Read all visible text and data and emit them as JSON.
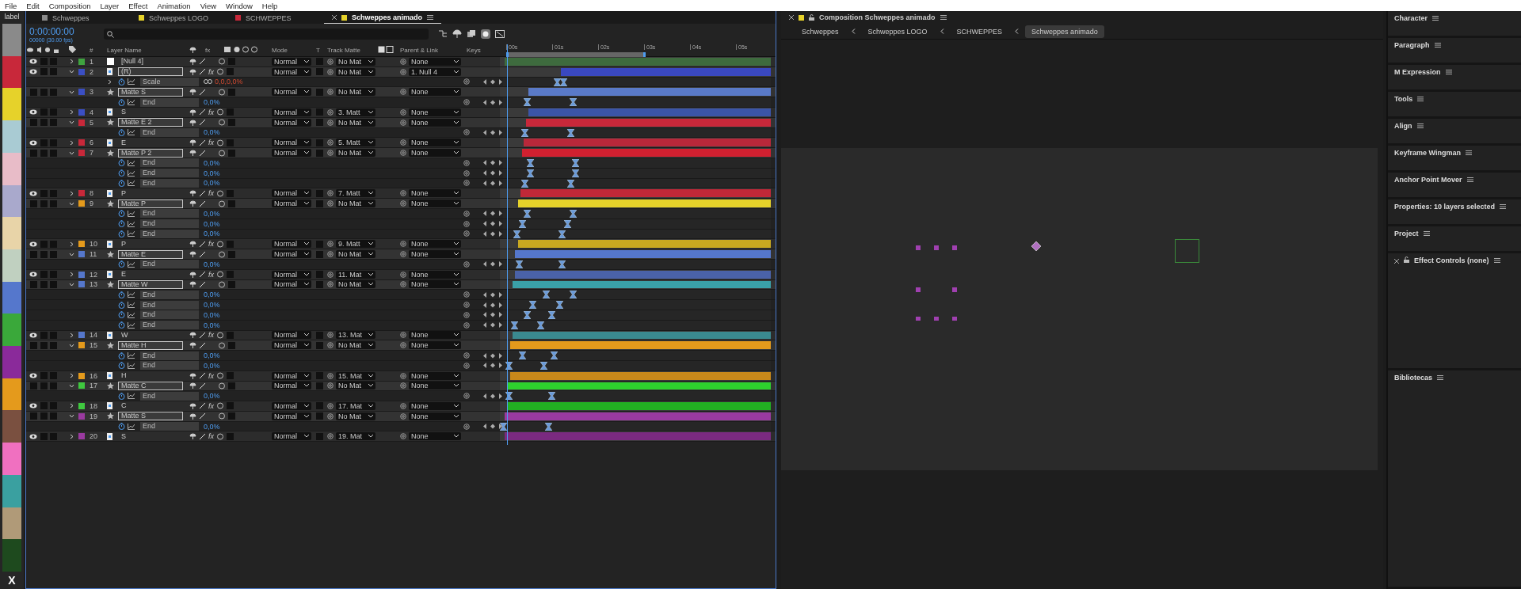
{
  "menu": [
    "File",
    "Edit",
    "Composition",
    "Layer",
    "Effect",
    "Animation",
    "View",
    "Window",
    "Help"
  ],
  "label_strip": {
    "title": "label",
    "close": "X",
    "swatches": [
      {
        "color": "#8a8a8a"
      },
      {
        "color": "#c8283a"
      },
      {
        "color": "#e6d22a"
      },
      {
        "color": "#a9cbd3"
      },
      {
        "color": "#e8bcc8"
      },
      {
        "color": "#a9a9cc"
      },
      {
        "color": "#e8d4a8"
      },
      {
        "color": "#c0d0c0"
      },
      {
        "color": "#5577cc"
      },
      {
        "color": "#3aa83a"
      },
      {
        "color": "#8a2a9a"
      },
      {
        "color": "#e49a1c"
      },
      {
        "color": "#7a5040"
      },
      {
        "color": "#f070c0"
      },
      {
        "color": "#3aa0a0"
      },
      {
        "color": "#b09a78"
      },
      {
        "color": "#1e4a1e"
      }
    ]
  },
  "timeline": {
    "tabs": [
      {
        "label": "Schweppes",
        "color": "#8a8a8a",
        "selected": false
      },
      {
        "label": "Schweppes LOGO",
        "color": "#e6d22a",
        "selected": false
      },
      {
        "label": "SCHWEPPES",
        "color": "#c8283a",
        "selected": false
      },
      {
        "label": "Schweppes animado",
        "color": "#e6d22a",
        "selected": true
      }
    ],
    "timecode": "0:00:00:00",
    "frame_info": "00000 (30.00 fps)",
    "columns": {
      "number": "#",
      "layer_name": "Layer Name",
      "fx": "fx",
      "mode": "Mode",
      "t": "T",
      "track_matte": "Track Matte",
      "parent": "Parent & Link",
      "keys": "Keys"
    },
    "ruler": [
      "00s",
      "01s",
      "02s",
      "03s",
      "04s",
      "05s"
    ],
    "rows": [
      {
        "kind": "null_layer",
        "number": "1",
        "name": "[Null 4]",
        "color": "#3fa33f",
        "selected": false,
        "visible": true,
        "expanded": false,
        "mode": "Normal",
        "track_matte": "No Mat",
        "parent": "None",
        "bar": {
          "color": "#3e6b3e",
          "level": 1
        }
      },
      {
        "kind": "shape_layer",
        "number": "2",
        "name": "(R)",
        "fx": "fx",
        "color": "#3b4fc4",
        "selected": true,
        "visible": true,
        "expanded": true,
        "mode": "Normal",
        "track_matte": "No Mat",
        "parent": "1. Null 4",
        "bar": {
          "color": "#3a48c0",
          "level": 0.79
        }
      },
      {
        "kind": "property",
        "name": "Scale",
        "value": "0,0,0,0%",
        "linked": true,
        "keyframes": [
          {
            "level": 0.2
          },
          {
            "level": 0.225
          }
        ]
      },
      {
        "kind": "matte_layer",
        "number": "3",
        "name": "Matte S",
        "color": "#3b4fc4",
        "selected": true,
        "visible": false,
        "expanded": true,
        "mode": "Normal",
        "track_matte": "No Mat",
        "parent": "None",
        "bar": {
          "color": "#5a7ac8",
          "level": 0.91
        }
      },
      {
        "kind": "property",
        "name": "End",
        "value": "0,0%",
        "linked": false,
        "keyframes": [
          {
            "level": 0.09
          },
          {
            "level": 0.26
          }
        ]
      },
      {
        "kind": "shape_layer",
        "number": "4",
        "name": "S",
        "fx": "fx",
        "color": "#3b4fc4",
        "selected": false,
        "visible": true,
        "expanded": false,
        "mode": "Normal",
        "track_matte": "3. Matt",
        "parent": "None",
        "bar": {
          "color": "#3b55a8",
          "level": 0.91
        }
      },
      {
        "kind": "matte_layer",
        "number": "5",
        "name": "Matte E 2",
        "color": "#c8283a",
        "selected": true,
        "visible": false,
        "expanded": true,
        "mode": "Normal",
        "track_matte": "No Mat",
        "parent": "None",
        "bar": {
          "color": "#c8283a",
          "level": 0.92
        }
      },
      {
        "kind": "property",
        "name": "End",
        "value": "0,0%",
        "linked": false,
        "keyframes": [
          {
            "level": 0.08
          },
          {
            "level": 0.25
          }
        ]
      },
      {
        "kind": "shape_layer",
        "number": "6",
        "name": "E",
        "fx": "fx",
        "color": "#c8283a",
        "selected": false,
        "visible": true,
        "expanded": false,
        "mode": "Normal",
        "track_matte": "5. Matt",
        "parent": "None",
        "bar": {
          "color": "#b8283a",
          "level": 0.93
        }
      },
      {
        "kind": "matte_layer",
        "number": "7",
        "name": "Matte P 2",
        "color": "#c8283a",
        "selected": true,
        "visible": false,
        "expanded": true,
        "mode": "Normal",
        "track_matte": "No Mat",
        "parent": "None",
        "bar": {
          "color": "#d02030",
          "level": 0.935
        }
      },
      {
        "kind": "property",
        "name": "End",
        "value": "0,0%",
        "linked": false,
        "keyframes": [
          {
            "level": 0.1
          },
          {
            "level": 0.27
          }
        ]
      },
      {
        "kind": "property",
        "name": "End",
        "value": "0,0%",
        "linked": false,
        "keyframes": [
          {
            "level": 0.1
          },
          {
            "level": 0.27
          }
        ]
      },
      {
        "kind": "property",
        "name": "End",
        "value": "0,0%",
        "linked": false,
        "keyframes": [
          {
            "level": 0.08
          },
          {
            "level": 0.25
          }
        ]
      },
      {
        "kind": "shape_layer",
        "number": "8",
        "name": "P",
        "fx": "fx",
        "color": "#c8283a",
        "selected": false,
        "visible": true,
        "expanded": false,
        "mode": "Normal",
        "track_matte": "7. Matt",
        "parent": "None",
        "bar": {
          "color": "#c02838",
          "level": 0.94
        }
      },
      {
        "kind": "matte_layer",
        "number": "9",
        "name": "Matte P",
        "color": "#e49a1c",
        "selected": true,
        "visible": false,
        "expanded": true,
        "mode": "Normal",
        "track_matte": "No Mat",
        "parent": "None",
        "bar": {
          "color": "#e6d22a",
          "level": 0.95
        }
      },
      {
        "kind": "property",
        "name": "End",
        "value": "0,0%",
        "linked": false,
        "keyframes": [
          {
            "level": 0.09
          },
          {
            "level": 0.26
          }
        ]
      },
      {
        "kind": "property",
        "name": "End",
        "value": "0,0%",
        "linked": false,
        "keyframes": [
          {
            "level": 0.07
          },
          {
            "level": 0.24
          }
        ]
      },
      {
        "kind": "property",
        "name": "End",
        "value": "0,0%",
        "linked": false,
        "keyframes": [
          {
            "level": 0.05
          },
          {
            "level": 0.22
          }
        ]
      },
      {
        "kind": "shape_layer",
        "number": "10",
        "name": "P",
        "fx": "fx",
        "color": "#e49a1c",
        "selected": false,
        "visible": true,
        "expanded": false,
        "mode": "Normal",
        "track_matte": "9. Matt",
        "parent": "None",
        "bar": {
          "color": "#c8a820",
          "level": 0.95
        }
      },
      {
        "kind": "matte_layer",
        "number": "11",
        "name": "Matte E",
        "color": "#5577cc",
        "selected": true,
        "visible": false,
        "expanded": true,
        "mode": "Normal",
        "track_matte": "No Mat",
        "parent": "None",
        "bar": {
          "color": "#5577cc",
          "level": 0.96
        }
      },
      {
        "kind": "property",
        "name": "End",
        "value": "0,0%",
        "linked": false,
        "keyframes": [
          {
            "level": 0.06
          },
          {
            "level": 0.22
          }
        ]
      },
      {
        "kind": "shape_layer",
        "number": "12",
        "name": "E",
        "fx": "fx",
        "color": "#5577cc",
        "selected": false,
        "visible": true,
        "expanded": false,
        "mode": "Normal",
        "track_matte": "11. Mat",
        "parent": "None",
        "bar": {
          "color": "#4a62a8",
          "level": 0.96
        }
      },
      {
        "kind": "matte_layer",
        "number": "13",
        "name": "Matte W",
        "color": "#5577cc",
        "selected": true,
        "visible": false,
        "expanded": true,
        "mode": "Normal",
        "track_matte": "No Mat",
        "parent": "None",
        "bar": {
          "color": "#3aa0a8",
          "level": 0.97
        }
      },
      {
        "kind": "property",
        "name": "End",
        "value": "0,0%",
        "linked": false,
        "keyframes": [
          {
            "level": 0.16
          },
          {
            "level": 0.26
          }
        ]
      },
      {
        "kind": "property",
        "name": "End",
        "value": "0,0%",
        "linked": false,
        "keyframes": [
          {
            "level": 0.11
          },
          {
            "level": 0.21
          }
        ]
      },
      {
        "kind": "property",
        "name": "End",
        "value": "0,0%",
        "linked": false,
        "keyframes": [
          {
            "level": 0.09
          },
          {
            "level": 0.18
          }
        ]
      },
      {
        "kind": "property",
        "name": "End",
        "value": "0,0%",
        "linked": false,
        "keyframes": [
          {
            "level": 0.04
          },
          {
            "level": 0.14
          }
        ]
      },
      {
        "kind": "shape_layer",
        "number": "14",
        "name": "W",
        "fx": "fx",
        "color": "#5577cc",
        "selected": false,
        "visible": true,
        "expanded": false,
        "mode": "Normal",
        "track_matte": "13. Mat",
        "parent": "None",
        "bar": {
          "color": "#3a8a90",
          "level": 0.97
        }
      },
      {
        "kind": "matte_layer",
        "number": "15",
        "name": "Matte H",
        "color": "#e49a1c",
        "selected": true,
        "visible": false,
        "expanded": true,
        "mode": "Normal",
        "track_matte": "No Mat",
        "parent": "None",
        "bar": {
          "color": "#e49a1c",
          "level": 0.98
        }
      },
      {
        "kind": "property",
        "name": "End",
        "value": "0,0%",
        "linked": false,
        "keyframes": [
          {
            "level": 0.07
          },
          {
            "level": 0.19
          }
        ]
      },
      {
        "kind": "property",
        "name": "End",
        "value": "0,0%",
        "linked": false,
        "keyframes": [
          {
            "level": 0.02
          },
          {
            "level": 0.15
          }
        ]
      },
      {
        "kind": "shape_layer",
        "number": "16",
        "name": "H",
        "fx": "fx",
        "color": "#e49a1c",
        "selected": false,
        "visible": true,
        "expanded": false,
        "mode": "Normal",
        "track_matte": "15. Mat",
        "parent": "None",
        "bar": {
          "color": "#c8881a",
          "level": 0.98
        }
      },
      {
        "kind": "matte_layer",
        "number": "17",
        "name": "Matte C",
        "color": "#3fc83f",
        "selected": true,
        "visible": false,
        "expanded": true,
        "mode": "Normal",
        "track_matte": "No Mat",
        "parent": "None",
        "bar": {
          "color": "#2ed02e",
          "level": 0.99
        }
      },
      {
        "kind": "property",
        "name": "End",
        "value": "0,0%",
        "linked": false,
        "keyframes": [
          {
            "level": 0.02
          },
          {
            "level": 0.18
          }
        ]
      },
      {
        "kind": "shape_layer",
        "number": "18",
        "name": "C",
        "fx": "fx",
        "color": "#3fc83f",
        "selected": false,
        "visible": true,
        "expanded": false,
        "mode": "Normal",
        "track_matte": "17. Mat",
        "parent": "None",
        "bar": {
          "color": "#22b022",
          "level": 0.99
        }
      },
      {
        "kind": "matte_layer",
        "number": "19",
        "name": "Matte S",
        "color": "#9a3aa0",
        "selected": true,
        "visible": false,
        "expanded": true,
        "mode": "Normal",
        "track_matte": "No Mat",
        "parent": "None",
        "bar": {
          "color": "#9a3aa0",
          "level": 1
        }
      },
      {
        "kind": "property",
        "name": "End",
        "value": "0,0%",
        "linked": false,
        "keyframes": [
          {
            "level": 0
          },
          {
            "level": 0.17
          }
        ]
      },
      {
        "kind": "shape_layer",
        "number": "20",
        "name": "S",
        "fx": "fx",
        "color": "#9a3aa0",
        "selected": false,
        "visible": true,
        "expanded": false,
        "mode": "Normal",
        "track_matte": "19. Mat",
        "parent": "None",
        "bar": {
          "color": "#7a2a80",
          "level": 1
        }
      }
    ]
  },
  "composition": {
    "title": "Composition Schweppes animado",
    "color": "#e6d22a",
    "breadcrumbs": [
      {
        "label": "Schweppes",
        "selected": false
      },
      {
        "label": "Schweppes LOGO",
        "selected": false
      },
      {
        "label": "SCHWEPPES",
        "selected": false
      },
      {
        "label": "Schweppes animado",
        "selected": true
      }
    ]
  },
  "panels": [
    {
      "title": "Character",
      "closable": false
    },
    {
      "title": "Paragraph",
      "closable": false
    },
    {
      "title": "M Expression",
      "closable": false
    },
    {
      "title": "Tools",
      "closable": false
    },
    {
      "title": "Align",
      "closable": false
    },
    {
      "title": "Keyframe Wingman",
      "closable": false
    },
    {
      "title": "Anchor Point Mover",
      "closable": false
    },
    {
      "title": "Properties: 10 layers selected",
      "closable": false
    },
    {
      "title": "Project",
      "closable": false
    },
    {
      "title": "Effect Controls (none)",
      "closable": true
    },
    {
      "title": "Bibliotecas",
      "closable": false
    }
  ]
}
